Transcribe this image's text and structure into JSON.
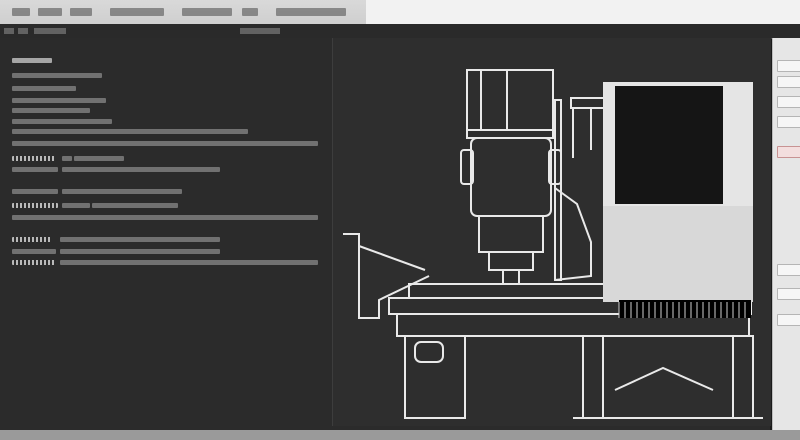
{
  "app": {
    "menu_items": [
      "",
      "",
      "",
      "",
      "",
      "",
      ""
    ]
  },
  "left_panel": {
    "lines": [
      "",
      "",
      "",
      "",
      "",
      "",
      "",
      "",
      "",
      "",
      "",
      "",
      "",
      "",
      "",
      ""
    ]
  },
  "viewport": {
    "model_name": ""
  },
  "colors": {
    "background": "#1b1b1b",
    "viewport": "#2e2e2e",
    "line_art": "#e9e9e9",
    "panel_light": "#e6e6e6"
  },
  "icons": {
    "cnc_machine": "cnc-machine-illustration"
  }
}
